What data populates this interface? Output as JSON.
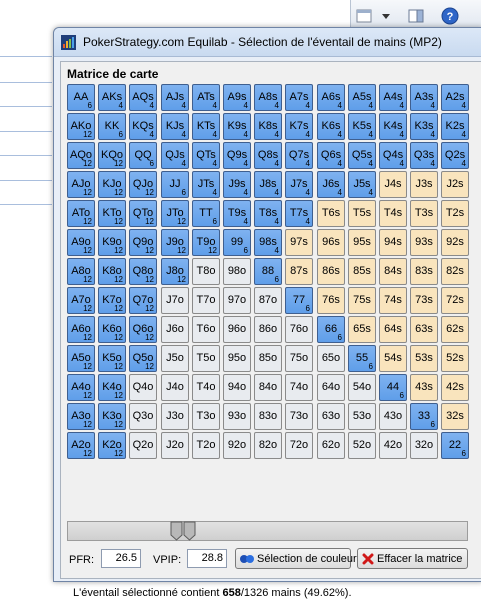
{
  "window": {
    "title": "PokerStrategy.com Equilab - Sélection de l'éventail de mains (MP2)"
  },
  "section_title": "Matrice de carte",
  "matrix": [
    [
      [
        "AA",
        6,
        "sel"
      ],
      [
        "AKs",
        4,
        "sel"
      ],
      [
        "AQs",
        4,
        "sel"
      ],
      [
        "AJs",
        4,
        "sel"
      ],
      [
        "ATs",
        4,
        "sel"
      ],
      [
        "A9s",
        4,
        "sel"
      ],
      [
        "A8s",
        4,
        "sel"
      ],
      [
        "A7s",
        4,
        "sel"
      ],
      [
        "A6s",
        4,
        "sel"
      ],
      [
        "A5s",
        4,
        "sel"
      ],
      [
        "A4s",
        4,
        "sel"
      ],
      [
        "A3s",
        4,
        "sel"
      ],
      [
        "A2s",
        4,
        "sel"
      ]
    ],
    [
      [
        "AKo",
        12,
        "sel"
      ],
      [
        "KK",
        6,
        "sel"
      ],
      [
        "KQs",
        4,
        "sel"
      ],
      [
        "KJs",
        4,
        "sel"
      ],
      [
        "KTs",
        4,
        "sel"
      ],
      [
        "K9s",
        4,
        "sel"
      ],
      [
        "K8s",
        4,
        "sel"
      ],
      [
        "K7s",
        4,
        "sel"
      ],
      [
        "K6s",
        4,
        "sel"
      ],
      [
        "K5s",
        4,
        "sel"
      ],
      [
        "K4s",
        4,
        "sel"
      ],
      [
        "K3s",
        4,
        "sel"
      ],
      [
        "K2s",
        4,
        "sel"
      ]
    ],
    [
      [
        "AQo",
        12,
        "sel"
      ],
      [
        "KQo",
        12,
        "sel"
      ],
      [
        "QQ",
        6,
        "sel"
      ],
      [
        "QJs",
        4,
        "sel"
      ],
      [
        "QTs",
        4,
        "sel"
      ],
      [
        "Q9s",
        4,
        "sel"
      ],
      [
        "Q8s",
        4,
        "sel"
      ],
      [
        "Q7s",
        4,
        "sel"
      ],
      [
        "Q6s",
        4,
        "sel"
      ],
      [
        "Q5s",
        4,
        "sel"
      ],
      [
        "Q4s",
        4,
        "sel"
      ],
      [
        "Q3s",
        4,
        "sel"
      ],
      [
        "Q2s",
        4,
        "sel"
      ]
    ],
    [
      [
        "AJo",
        12,
        "sel"
      ],
      [
        "KJo",
        12,
        "sel"
      ],
      [
        "QJo",
        12,
        "sel"
      ],
      [
        "JJ",
        6,
        "sel"
      ],
      [
        "JTs",
        4,
        "sel"
      ],
      [
        "J9s",
        4,
        "sel"
      ],
      [
        "J8s",
        4,
        "sel"
      ],
      [
        "J7s",
        4,
        "sel"
      ],
      [
        "J6s",
        4,
        "sel"
      ],
      [
        "J5s",
        4,
        "sel"
      ],
      [
        "J4s",
        null,
        "pair"
      ],
      [
        "J3s",
        null,
        "pair"
      ],
      [
        "J2s",
        null,
        "pair"
      ]
    ],
    [
      [
        "ATo",
        12,
        "sel"
      ],
      [
        "KTo",
        12,
        "sel"
      ],
      [
        "QTo",
        12,
        "sel"
      ],
      [
        "JTo",
        12,
        "sel"
      ],
      [
        "TT",
        6,
        "sel"
      ],
      [
        "T9s",
        4,
        "sel"
      ],
      [
        "T8s",
        4,
        "sel"
      ],
      [
        "T7s",
        4,
        "sel"
      ],
      [
        "T6s",
        null,
        "pair"
      ],
      [
        "T5s",
        null,
        "pair"
      ],
      [
        "T4s",
        null,
        "pair"
      ],
      [
        "T3s",
        null,
        "pair"
      ],
      [
        "T2s",
        null,
        "pair"
      ]
    ],
    [
      [
        "A9o",
        12,
        "sel"
      ],
      [
        "K9o",
        12,
        "sel"
      ],
      [
        "Q9o",
        12,
        "sel"
      ],
      [
        "J9o",
        12,
        "sel"
      ],
      [
        "T9o",
        12,
        "sel"
      ],
      [
        "99",
        6,
        "sel"
      ],
      [
        "98s",
        4,
        "sel"
      ],
      [
        "97s",
        null,
        "pair"
      ],
      [
        "96s",
        null,
        "pair"
      ],
      [
        "95s",
        null,
        "pair"
      ],
      [
        "94s",
        null,
        "pair"
      ],
      [
        "93s",
        null,
        "pair"
      ],
      [
        "92s",
        null,
        "pair"
      ]
    ],
    [
      [
        "A8o",
        12,
        "sel"
      ],
      [
        "K8o",
        12,
        "sel"
      ],
      [
        "Q8o",
        12,
        "sel"
      ],
      [
        "J8o",
        12,
        "sel"
      ],
      [
        "T8o",
        null,
        "off"
      ],
      [
        "98o",
        null,
        "off"
      ],
      [
        "88",
        6,
        "sel"
      ],
      [
        "87s",
        null,
        "pair"
      ],
      [
        "86s",
        null,
        "pair"
      ],
      [
        "85s",
        null,
        "pair"
      ],
      [
        "84s",
        null,
        "pair"
      ],
      [
        "83s",
        null,
        "pair"
      ],
      [
        "82s",
        null,
        "pair"
      ]
    ],
    [
      [
        "A7o",
        12,
        "sel"
      ],
      [
        "K7o",
        12,
        "sel"
      ],
      [
        "Q7o",
        12,
        "sel"
      ],
      [
        "J7o",
        null,
        "off"
      ],
      [
        "T7o",
        null,
        "off"
      ],
      [
        "97o",
        null,
        "off"
      ],
      [
        "87o",
        null,
        "off"
      ],
      [
        "77",
        6,
        "sel"
      ],
      [
        "76s",
        null,
        "pair"
      ],
      [
        "75s",
        null,
        "pair"
      ],
      [
        "74s",
        null,
        "pair"
      ],
      [
        "73s",
        null,
        "pair"
      ],
      [
        "72s",
        null,
        "pair"
      ]
    ],
    [
      [
        "A6o",
        12,
        "sel"
      ],
      [
        "K6o",
        12,
        "sel"
      ],
      [
        "Q6o",
        12,
        "sel"
      ],
      [
        "J6o",
        null,
        "off"
      ],
      [
        "T6o",
        null,
        "off"
      ],
      [
        "96o",
        null,
        "off"
      ],
      [
        "86o",
        null,
        "off"
      ],
      [
        "76o",
        null,
        "off"
      ],
      [
        "66",
        6,
        "sel"
      ],
      [
        "65s",
        null,
        "pair"
      ],
      [
        "64s",
        null,
        "pair"
      ],
      [
        "63s",
        null,
        "pair"
      ],
      [
        "62s",
        null,
        "pair"
      ]
    ],
    [
      [
        "A5o",
        12,
        "sel"
      ],
      [
        "K5o",
        12,
        "sel"
      ],
      [
        "Q5o",
        12,
        "sel"
      ],
      [
        "J5o",
        null,
        "off"
      ],
      [
        "T5o",
        null,
        "off"
      ],
      [
        "95o",
        null,
        "off"
      ],
      [
        "85o",
        null,
        "off"
      ],
      [
        "75o",
        null,
        "off"
      ],
      [
        "65o",
        null,
        "off"
      ],
      [
        "55",
        6,
        "sel"
      ],
      [
        "54s",
        null,
        "pair"
      ],
      [
        "53s",
        null,
        "pair"
      ],
      [
        "52s",
        null,
        "pair"
      ]
    ],
    [
      [
        "A4o",
        12,
        "sel"
      ],
      [
        "K4o",
        12,
        "sel"
      ],
      [
        "Q4o",
        null,
        "off"
      ],
      [
        "J4o",
        null,
        "off"
      ],
      [
        "T4o",
        null,
        "off"
      ],
      [
        "94o",
        null,
        "off"
      ],
      [
        "84o",
        null,
        "off"
      ],
      [
        "74o",
        null,
        "off"
      ],
      [
        "64o",
        null,
        "off"
      ],
      [
        "54o",
        null,
        "off"
      ],
      [
        "44",
        6,
        "sel"
      ],
      [
        "43s",
        null,
        "pair"
      ],
      [
        "42s",
        null,
        "pair"
      ]
    ],
    [
      [
        "A3o",
        12,
        "sel"
      ],
      [
        "K3o",
        12,
        "sel"
      ],
      [
        "Q3o",
        null,
        "off"
      ],
      [
        "J3o",
        null,
        "off"
      ],
      [
        "T3o",
        null,
        "off"
      ],
      [
        "93o",
        null,
        "off"
      ],
      [
        "83o",
        null,
        "off"
      ],
      [
        "73o",
        null,
        "off"
      ],
      [
        "63o",
        null,
        "off"
      ],
      [
        "53o",
        null,
        "off"
      ],
      [
        "43o",
        null,
        "off"
      ],
      [
        "33",
        6,
        "sel"
      ],
      [
        "32s",
        null,
        "pair"
      ]
    ],
    [
      [
        "A2o",
        12,
        "sel"
      ],
      [
        "K2o",
        12,
        "sel"
      ],
      [
        "Q2o",
        null,
        "off"
      ],
      [
        "J2o",
        null,
        "off"
      ],
      [
        "T2o",
        null,
        "off"
      ],
      [
        "92o",
        null,
        "off"
      ],
      [
        "82o",
        null,
        "off"
      ],
      [
        "72o",
        null,
        "off"
      ],
      [
        "62o",
        null,
        "off"
      ],
      [
        "52o",
        null,
        "off"
      ],
      [
        "42o",
        null,
        "off"
      ],
      [
        "32o",
        null,
        "off"
      ],
      [
        "22",
        6,
        "sel"
      ]
    ]
  ],
  "controls": {
    "pfr_label": "PFR:",
    "pfr_value": "26.5",
    "vpip_label": "VPIP:",
    "vpip_value": "28.8",
    "color_button": "Sélection de couleur",
    "clear_button": "Effacer la matrice"
  },
  "status": {
    "prefix": "L'éventail sélectionné contient ",
    "selected": "658",
    "total_suffix": "/1326 mains (49.62%)."
  },
  "colors": {
    "selected": "#6aa6ec",
    "unselected_suited": "#f9e4bd",
    "unselected_offsuit": "#e8ebef"
  }
}
